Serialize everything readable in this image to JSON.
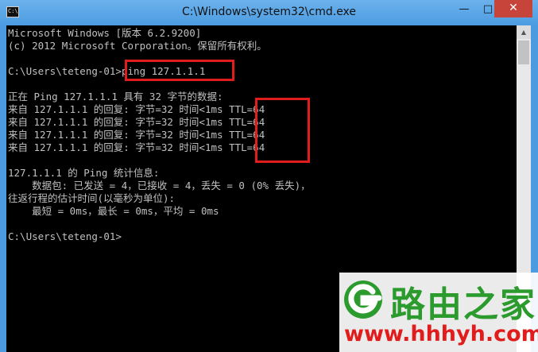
{
  "window": {
    "title": "C:\\Windows\\system32\\cmd.exe",
    "icon_label": "C:\\",
    "buttons": {
      "minimize": "—",
      "maximize": "□",
      "close": "✕"
    }
  },
  "console": {
    "lines": [
      "Microsoft Windows [版本 6.2.9200]",
      "(c) 2012 Microsoft Corporation。保留所有权利。",
      "",
      "C:\\Users\\teteng-01>ping 127.1.1.1",
      "",
      "正在 Ping 127.1.1.1 具有 32 字节的数据:",
      "来自 127.1.1.1 的回复: 字节=32 时间<1ms TTL=64",
      "来自 127.1.1.1 的回复: 字节=32 时间<1ms TTL=64",
      "来自 127.1.1.1 的回复: 字节=32 时间<1ms TTL=64",
      "来自 127.1.1.1 的回复: 字节=32 时间<1ms TTL=64",
      "",
      "127.1.1.1 的 Ping 统计信息:",
      "    数据包: 已发送 = 4，已接收 = 4，丢失 = 0 (0% 丢失)，",
      "往返行程的估计时间(以毫秒为单位):",
      "    最短 = 0ms，最长 = 0ms，平均 = 0ms",
      "",
      "C:\\Users\\teteng-01>"
    ]
  },
  "watermark": {
    "brand": "路由之家",
    "url": "www.hhhyh.com"
  },
  "colors": {
    "console_bg": "#000000",
    "console_text": "#c0c0c0",
    "highlight": "#e01c1c",
    "brand_green": "#2c9b2e"
  }
}
